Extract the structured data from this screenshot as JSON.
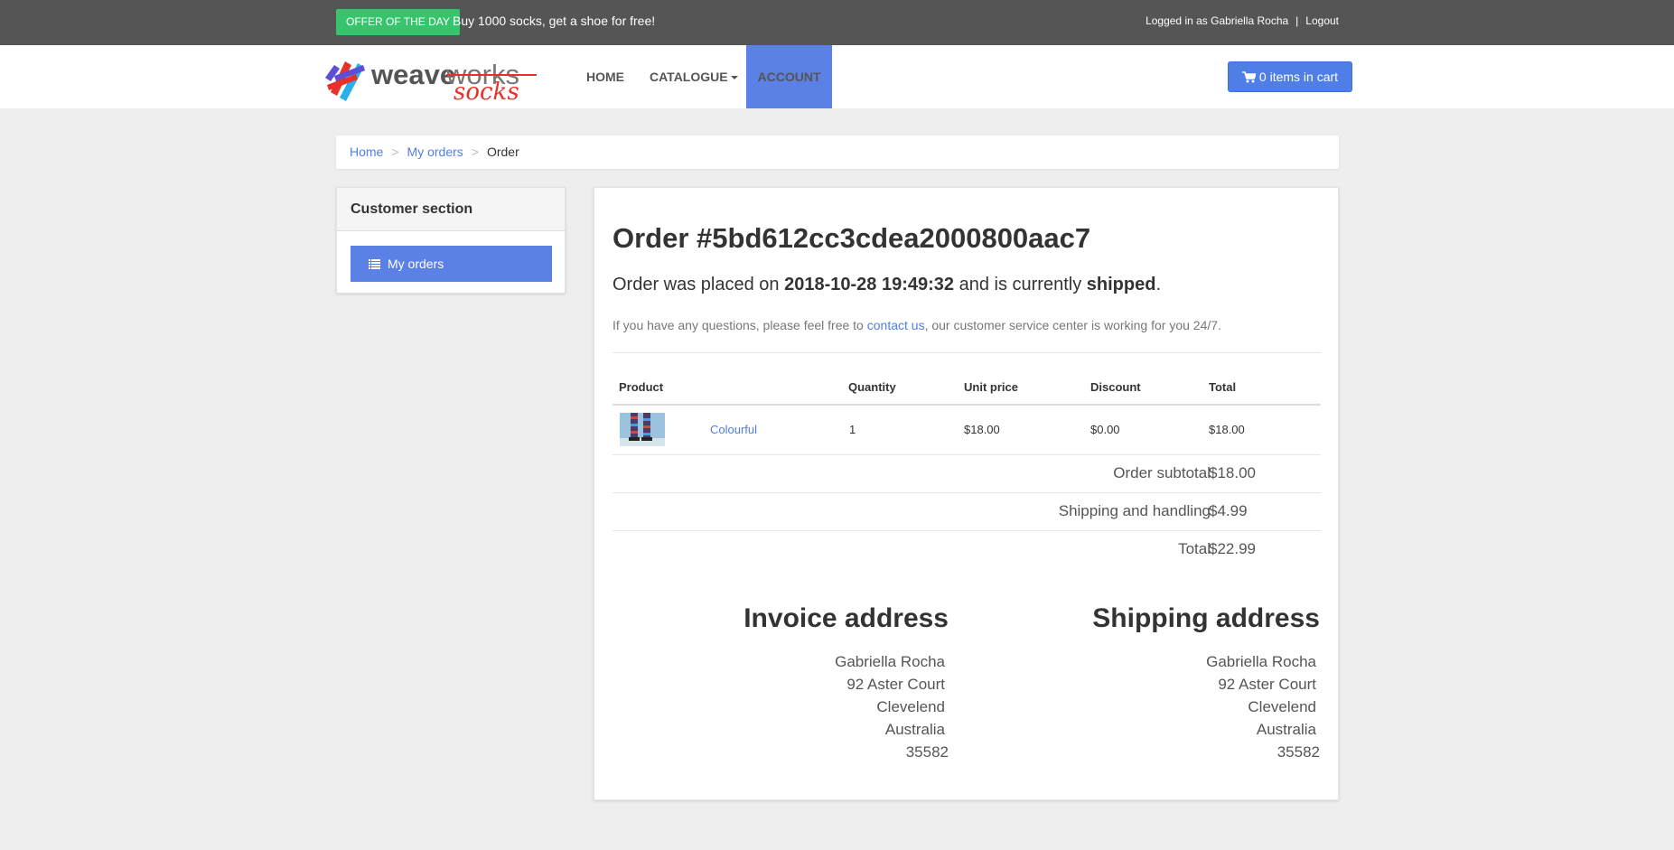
{
  "topbar": {
    "offer_badge": "OFFER OF THE DAY",
    "offer_text": "Buy 1000 socks, get a shoe for free!",
    "logged_in": "Logged in as Gabriella Rocha",
    "separator": "|",
    "logout": "Logout"
  },
  "nav": {
    "logo_primary": "weave",
    "logo_secondary": "works",
    "logo_tertiary": "socks",
    "home": "HOME",
    "catalogue": "CATALOGUE",
    "account": "ACCOUNT",
    "cart": "0 items in cart"
  },
  "breadcrumb": {
    "home": "Home",
    "separator": ">",
    "my_orders": "My orders",
    "current": "Order"
  },
  "sidebar": {
    "title": "Customer section",
    "my_orders": "My orders"
  },
  "order": {
    "title": "Order #5bd612cc3cdea2000800aac7",
    "status_prefix": "Order was placed on ",
    "date": "2018-10-28 19:49:32",
    "status_mid": " and is currently ",
    "status": "shipped",
    "status_suffix": ".",
    "help_prefix": "If you have any questions, please feel free to ",
    "help_link": "contact us",
    "help_suffix": ", our customer service center is working for you 24/7."
  },
  "table": {
    "headers": [
      "Product",
      "Quantity",
      "Unit price",
      "Discount",
      "Total"
    ],
    "rows": [
      {
        "product": "Colourful",
        "quantity": "1",
        "unit_price": "$18.00",
        "discount": "$0.00",
        "total": "$18.00"
      }
    ],
    "subtotal_label": "Order subtotal",
    "subtotal": "$18.00",
    "shipping_label": "Shipping and handling",
    "shipping": "$4.99",
    "total_label": "Total",
    "total": "$22.99"
  },
  "invoice": {
    "title": "Invoice address",
    "lines": [
      "Gabriella Rocha",
      "92 Aster Court",
      "Clevelend",
      "Australia",
      "35582"
    ]
  },
  "shipping": {
    "title": "Shipping address",
    "lines": [
      "Gabriella Rocha",
      "92 Aster Court",
      "Clevelend",
      "Australia",
      "35582"
    ]
  },
  "colors": {
    "accent": "#5b80e6",
    "offer_green": "#38c46c",
    "topbar": "#555555"
  }
}
